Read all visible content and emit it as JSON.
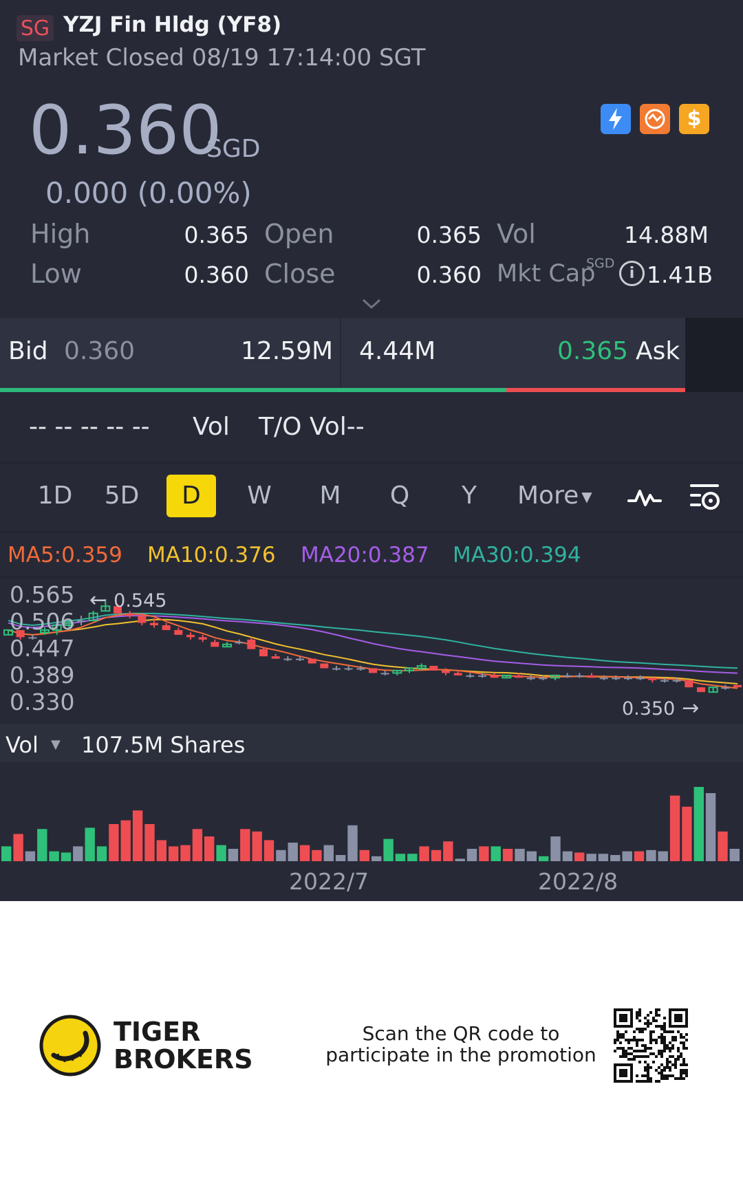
{
  "header": {
    "market_badge": "SG",
    "name": "YZJ Fin Hldg (YF8)",
    "status": "Market Closed 08/19 17:14:00 SGT"
  },
  "quote": {
    "price": "0.360",
    "currency": "SGD",
    "change": "0.000 (0.00%)"
  },
  "icons": [
    {
      "name": "lightning-icon",
      "color": "#3d8bf5"
    },
    {
      "name": "exchange-icon",
      "color": "#f27a32"
    },
    {
      "name": "dollar-icon",
      "color": "#f5a623"
    }
  ],
  "stats": {
    "high_label": "High",
    "high": "0.365",
    "low_label": "Low",
    "low": "0.360",
    "open_label": "Open",
    "open": "0.365",
    "close_label": "Close",
    "close": "0.360",
    "vol_label": "Vol",
    "vol": "14.88M",
    "mktcap_label": "Mkt Cap",
    "mktcap_currency": "SGD",
    "mktcap": "1.41B"
  },
  "bidask": {
    "bid_label": "Bid",
    "bid_price": "0.360",
    "bid_size": "12.59M",
    "ask_size": "4.44M",
    "ask_price": "0.365",
    "ask_label": "Ask",
    "bid_share": 0.74
  },
  "turnover": {
    "dashes": "-- -- -- -- --",
    "vol_label": "Vol",
    "to_vol_label": "T/O Vol--"
  },
  "period_tabs": [
    "1D",
    "5D",
    "D",
    "W",
    "M",
    "Q",
    "Y",
    "More"
  ],
  "active_tab": "D",
  "ma": {
    "ma5": "MA5:0.359",
    "ma10": "MA10:0.376",
    "ma20": "MA20:0.387",
    "ma30": "MA30:0.394"
  },
  "colors": {
    "up": "#2fc07a",
    "down": "#ee4d52",
    "flat": "#8a90a6",
    "ma5": "#f26a3a",
    "ma10": "#f2c12e",
    "ma20": "#a65de8",
    "ma30": "#2fb3a0",
    "accent": "#f5d70a"
  },
  "price_axis": [
    "0.565",
    "0.506",
    "0.447",
    "0.389",
    "0.330"
  ],
  "price_annotations": {
    "high_marker": "0.545",
    "low_marker": "0.350"
  },
  "volume": {
    "label": "Vol",
    "value": "107.5M Shares",
    "x_labels": [
      "2022/7",
      "2022/8"
    ]
  },
  "chart_data": {
    "type": "candlestick",
    "y_ticks": [
      0.565,
      0.506,
      0.447,
      0.389,
      0.33
    ],
    "ylim": [
      0.33,
      0.565
    ],
    "candles": [
      [
        0.47,
        0.48,
        0.47,
        0.48
      ],
      [
        0.48,
        0.48,
        0.46,
        0.465
      ],
      [
        0.465,
        0.47,
        0.46,
        0.465
      ],
      [
        0.475,
        0.485,
        0.47,
        0.48
      ],
      [
        0.48,
        0.49,
        0.47,
        0.49
      ],
      [
        0.49,
        0.5,
        0.48,
        0.495
      ],
      [
        0.5,
        0.51,
        0.49,
        0.5
      ],
      [
        0.5,
        0.52,
        0.5,
        0.515
      ],
      [
        0.52,
        0.545,
        0.52,
        0.53
      ],
      [
        0.53,
        0.535,
        0.51,
        0.515
      ],
      [
        0.515,
        0.52,
        0.505,
        0.51
      ],
      [
        0.51,
        0.515,
        0.49,
        0.495
      ],
      [
        0.495,
        0.505,
        0.485,
        0.49
      ],
      [
        0.49,
        0.495,
        0.48,
        0.48
      ],
      [
        0.48,
        0.485,
        0.47,
        0.47
      ],
      [
        0.47,
        0.475,
        0.46,
        0.465
      ],
      [
        0.465,
        0.47,
        0.455,
        0.46
      ],
      [
        0.455,
        0.46,
        0.445,
        0.445
      ],
      [
        0.445,
        0.455,
        0.445,
        0.45
      ],
      [
        0.455,
        0.46,
        0.45,
        0.455
      ],
      [
        0.46,
        0.465,
        0.44,
        0.44
      ],
      [
        0.44,
        0.445,
        0.425,
        0.425
      ],
      [
        0.425,
        0.43,
        0.42,
        0.42
      ],
      [
        0.42,
        0.425,
        0.415,
        0.42
      ],
      [
        0.42,
        0.425,
        0.415,
        0.42
      ],
      [
        0.42,
        0.42,
        0.41,
        0.41
      ],
      [
        0.41,
        0.41,
        0.4,
        0.4
      ],
      [
        0.4,
        0.405,
        0.395,
        0.4
      ],
      [
        0.4,
        0.405,
        0.395,
        0.4
      ],
      [
        0.4,
        0.405,
        0.395,
        0.4
      ],
      [
        0.4,
        0.4,
        0.39,
        0.39
      ],
      [
        0.39,
        0.395,
        0.385,
        0.39
      ],
      [
        0.39,
        0.395,
        0.385,
        0.395
      ],
      [
        0.395,
        0.4,
        0.39,
        0.4
      ],
      [
        0.4,
        0.41,
        0.395,
        0.405
      ],
      [
        0.405,
        0.405,
        0.395,
        0.395
      ],
      [
        0.395,
        0.4,
        0.385,
        0.39
      ],
      [
        0.39,
        0.395,
        0.385,
        0.385
      ],
      [
        0.385,
        0.39,
        0.38,
        0.385
      ],
      [
        0.385,
        0.39,
        0.38,
        0.385
      ],
      [
        0.385,
        0.39,
        0.38,
        0.38
      ],
      [
        0.38,
        0.385,
        0.38,
        0.385
      ],
      [
        0.385,
        0.39,
        0.38,
        0.38
      ],
      [
        0.38,
        0.385,
        0.375,
        0.38
      ],
      [
        0.38,
        0.385,
        0.375,
        0.38
      ],
      [
        0.38,
        0.385,
        0.375,
        0.385
      ],
      [
        0.385,
        0.39,
        0.38,
        0.385
      ],
      [
        0.385,
        0.39,
        0.38,
        0.385
      ],
      [
        0.385,
        0.39,
        0.38,
        0.38
      ],
      [
        0.38,
        0.385,
        0.375,
        0.38
      ],
      [
        0.38,
        0.385,
        0.375,
        0.38
      ],
      [
        0.38,
        0.385,
        0.375,
        0.38
      ],
      [
        0.38,
        0.385,
        0.375,
        0.38
      ],
      [
        0.38,
        0.38,
        0.37,
        0.375
      ],
      [
        0.375,
        0.38,
        0.37,
        0.375
      ],
      [
        0.375,
        0.38,
        0.37,
        0.375
      ],
      [
        0.375,
        0.375,
        0.36,
        0.36
      ],
      [
        0.36,
        0.36,
        0.35,
        0.35
      ],
      [
        0.35,
        0.36,
        0.35,
        0.36
      ],
      [
        0.36,
        0.365,
        0.355,
        0.36
      ],
      [
        0.365,
        0.365,
        0.36,
        0.36
      ]
    ],
    "volume": [
      12,
      22,
      8,
      26,
      8,
      7,
      12,
      27,
      12,
      30,
      33,
      41,
      30,
      17,
      12,
      13,
      26,
      20,
      13,
      10,
      26,
      24,
      17,
      9,
      15,
      13,
      9,
      13,
      5,
      29,
      9,
      4,
      18,
      6,
      6,
      12,
      9,
      16,
      2,
      10,
      12,
      12,
      10,
      10,
      8,
      4,
      20,
      8,
      7,
      6,
      6,
      5,
      8,
      8,
      9,
      8,
      53,
      44,
      60,
      55,
      24,
      10
    ]
  }
}
